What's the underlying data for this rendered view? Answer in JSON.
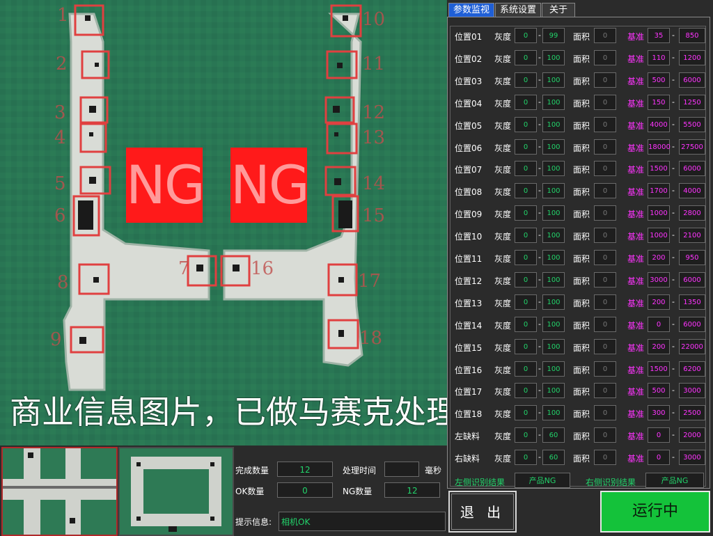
{
  "camera": {
    "markers_left": [
      "1",
      "2",
      "3",
      "4",
      "5",
      "6",
      "8",
      "9"
    ],
    "markers_right": [
      "10",
      "11",
      "12",
      "13",
      "14",
      "15",
      "17",
      "18"
    ],
    "marker_mid_left": "7",
    "marker_mid_right": "16",
    "ng_left": "NG",
    "ng_right": "NG",
    "caption": "商业信息图片，已做马赛克处理"
  },
  "stats": {
    "completed_label": "完成数量",
    "completed_value": "12",
    "time_label": "处理时间",
    "time_value": "",
    "time_unit": "毫秒",
    "ok_label": "OK数量",
    "ok_value": "0",
    "ng_label": "NG数量",
    "ng_value": "12",
    "info_label": "提示信息:",
    "info_value": "相机OK"
  },
  "tabs": [
    "参数监视",
    "系统设置",
    "关于"
  ],
  "params": {
    "gray_label": "灰度",
    "area_label": "面积",
    "base_label": "基准",
    "rows": [
      {
        "name": "位置01",
        "g1": "0",
        "g2": "99",
        "area": "0",
        "b1": "35",
        "b2": "850"
      },
      {
        "name": "位置02",
        "g1": "0",
        "g2": "100",
        "area": "0",
        "b1": "110",
        "b2": "1200"
      },
      {
        "name": "位置03",
        "g1": "0",
        "g2": "100",
        "area": "0",
        "b1": "500",
        "b2": "6000"
      },
      {
        "name": "位置04",
        "g1": "0",
        "g2": "100",
        "area": "0",
        "b1": "150",
        "b2": "1250"
      },
      {
        "name": "位置05",
        "g1": "0",
        "g2": "100",
        "area": "0",
        "b1": "4000",
        "b2": "5500"
      },
      {
        "name": "位置06",
        "g1": "0",
        "g2": "100",
        "area": "0",
        "b1": "18000",
        "b2": "27500"
      },
      {
        "name": "位置07",
        "g1": "0",
        "g2": "100",
        "area": "0",
        "b1": "1500",
        "b2": "6000"
      },
      {
        "name": "位置08",
        "g1": "0",
        "g2": "100",
        "area": "0",
        "b1": "1700",
        "b2": "4000"
      },
      {
        "name": "位置09",
        "g1": "0",
        "g2": "100",
        "area": "0",
        "b1": "1000",
        "b2": "2800"
      },
      {
        "name": "位置10",
        "g1": "0",
        "g2": "100",
        "area": "0",
        "b1": "1000",
        "b2": "2100"
      },
      {
        "name": "位置11",
        "g1": "0",
        "g2": "100",
        "area": "0",
        "b1": "200",
        "b2": "950"
      },
      {
        "name": "位置12",
        "g1": "0",
        "g2": "100",
        "area": "0",
        "b1": "3000",
        "b2": "6000"
      },
      {
        "name": "位置13",
        "g1": "0",
        "g2": "100",
        "area": "0",
        "b1": "200",
        "b2": "1350"
      },
      {
        "name": "位置14",
        "g1": "0",
        "g2": "100",
        "area": "0",
        "b1": "0",
        "b2": "6000"
      },
      {
        "name": "位置15",
        "g1": "0",
        "g2": "100",
        "area": "0",
        "b1": "200",
        "b2": "22000"
      },
      {
        "name": "位置16",
        "g1": "0",
        "g2": "100",
        "area": "0",
        "b1": "1500",
        "b2": "6200"
      },
      {
        "name": "位置17",
        "g1": "0",
        "g2": "100",
        "area": "0",
        "b1": "500",
        "b2": "3000"
      },
      {
        "name": "位置18",
        "g1": "0",
        "g2": "100",
        "area": "0",
        "b1": "300",
        "b2": "2500"
      },
      {
        "name": "左缺料",
        "g1": "0",
        "g2": "60",
        "area": "0",
        "b1": "0",
        "b2": "2000"
      },
      {
        "name": "右缺料",
        "g1": "0",
        "g2": "60",
        "area": "0",
        "b1": "0",
        "b2": "3000"
      }
    ],
    "left_result_label": "左侧识别结果",
    "left_result_value": "产品NG",
    "right_result_label": "右侧识别结果",
    "right_result_value": "产品NG"
  },
  "buttons": {
    "exit": "退 出",
    "run": "运行中"
  },
  "colors": {
    "background": "#2b2b2b",
    "value_green": "#22d36a",
    "base_magenta": "#ff33ff",
    "tab_active": "#1f5fd6",
    "ng_red": "#ff1a1a",
    "run_green": "#14c23a",
    "camera_bg": "#2c7a57"
  }
}
